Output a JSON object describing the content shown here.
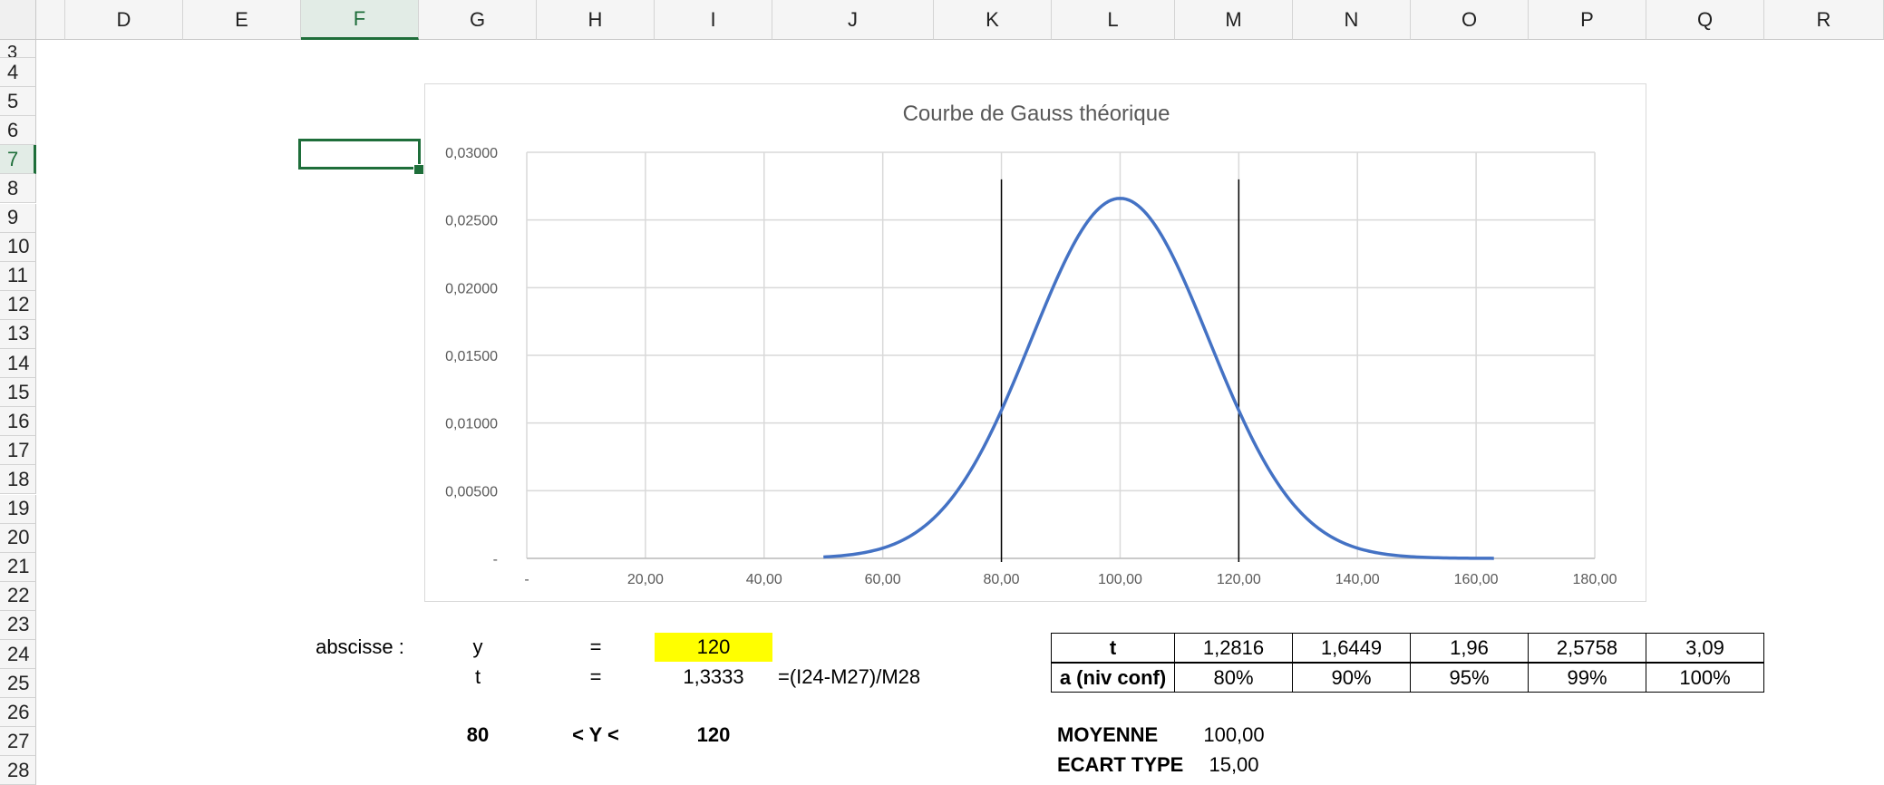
{
  "columns": [
    "D",
    "E",
    "F",
    "G",
    "H",
    "I",
    "J",
    "K",
    "L",
    "M",
    "N",
    "O",
    "P",
    "Q",
    "R"
  ],
  "selected_column": "F",
  "rows": [
    "3",
    "4",
    "5",
    "6",
    "7",
    "8",
    "9",
    "10",
    "11",
    "12",
    "13",
    "14",
    "15",
    "16",
    "17",
    "18",
    "19",
    "20",
    "21",
    "22",
    "23",
    "24",
    "25",
    "26",
    "27",
    "28"
  ],
  "selected_row": "7",
  "cells": {
    "abscisse_label": "abscisse :",
    "y_label": "y",
    "eq1": "=",
    "y_value": "120",
    "t_label": "t",
    "eq2": "=",
    "t_value": "1,3333",
    "formula": "=(I24-M27)/M28",
    "lower": "80",
    "interval": "< Y <",
    "upper": "120",
    "moyenne_label": "MOYENNE",
    "moyenne_value": "100,00",
    "ecart_label": "ECART TYPE",
    "ecart_value": "15,00"
  },
  "conf_table": {
    "t_header": "t",
    "t_values": [
      "1,2816",
      "1,6449",
      "1,96",
      "2,5758",
      "3,09"
    ],
    "a_header": "a (niv conf)",
    "a_values": [
      "80%",
      "90%",
      "95%",
      "99%",
      "100%"
    ]
  },
  "chart_data": {
    "type": "line",
    "title": "Courbe de Gauss théorique",
    "mean": 100,
    "std": 15,
    "x_range": [
      50,
      163
    ],
    "xlim": [
      0,
      180
    ],
    "ylim": [
      0,
      0.03
    ],
    "x_tick_labels": [
      "-",
      "20,00",
      "40,00",
      "60,00",
      "80,00",
      "100,00",
      "120,00",
      "140,00",
      "160,00",
      "180,00"
    ],
    "y_tick_labels": [
      "-",
      "0,00500",
      "0,01000",
      "0,01500",
      "0,02000",
      "0,02500",
      "0,03000"
    ],
    "vertical_lines": [
      80,
      120
    ],
    "vertical_line_top": 0.028,
    "grid": true,
    "series_color": "#4472c4"
  }
}
